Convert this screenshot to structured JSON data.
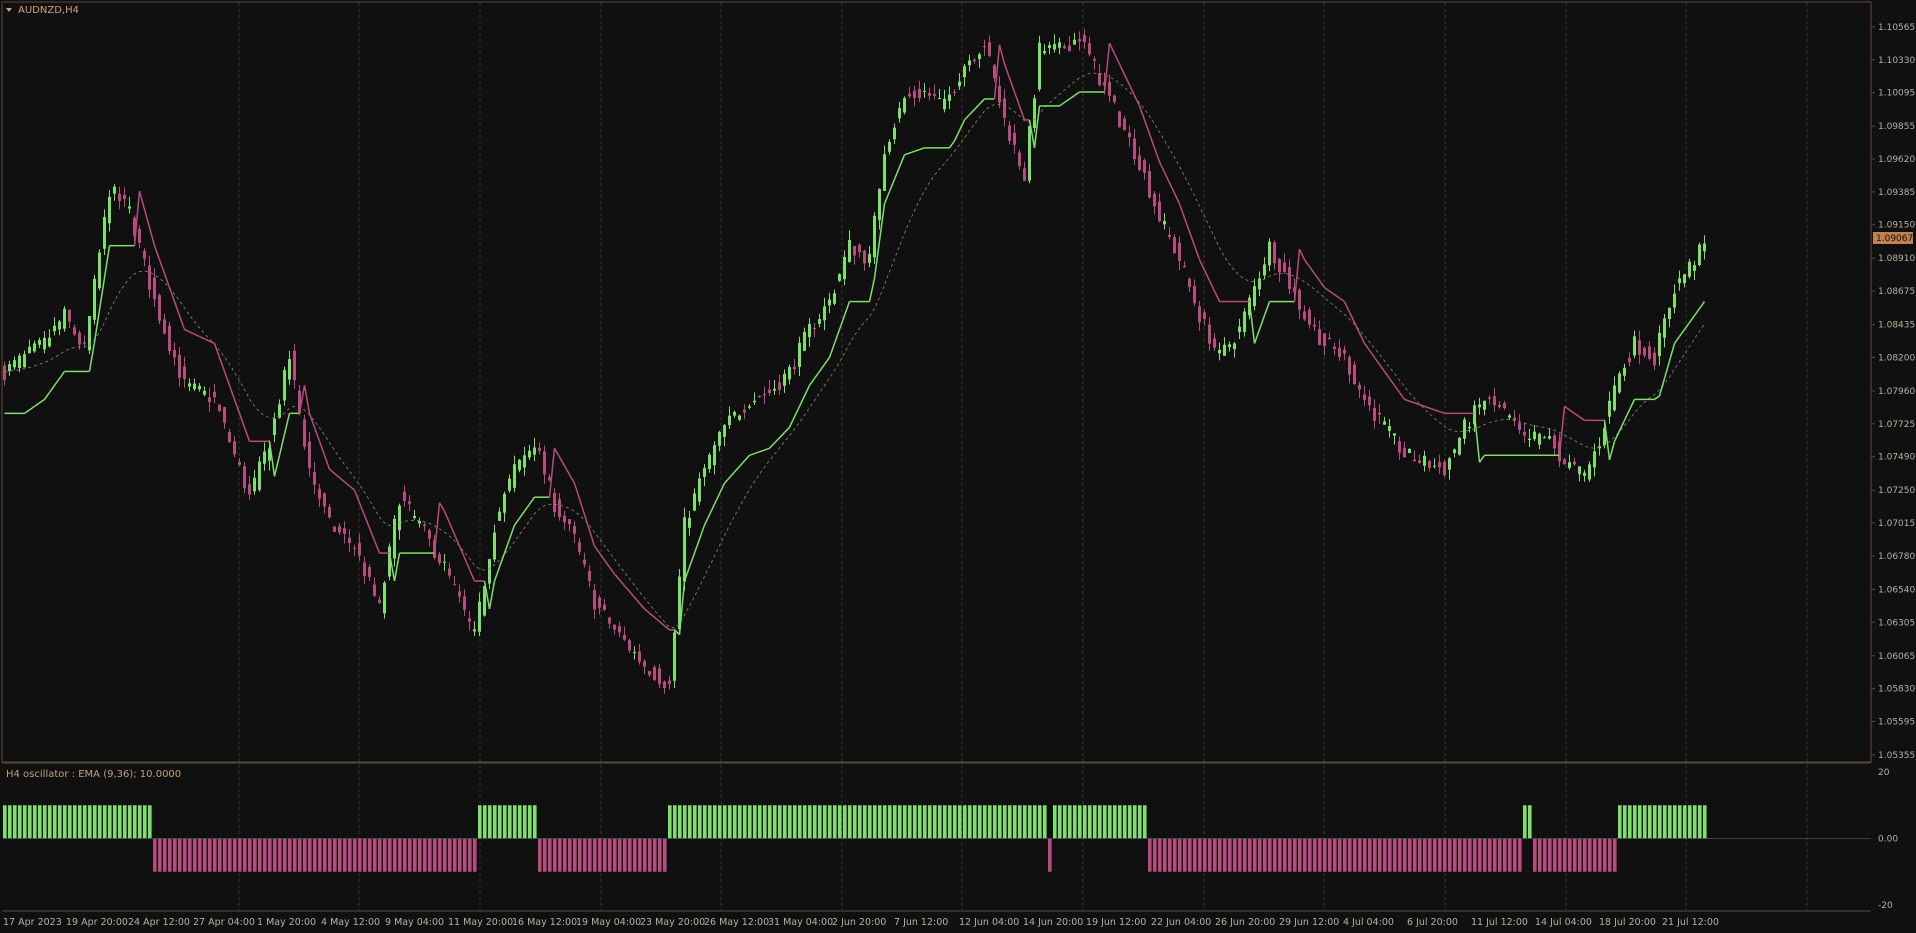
{
  "chart_title": "AUDNZD,H4",
  "oscillator_label": "H4  oscillator : EMA (9,36); 10.0000",
  "current_price_label": "1.09067",
  "colors": {
    "background": "#101010",
    "bull": "#7ee06a",
    "bear": "#b84c7c",
    "frame": "#5a4a3a",
    "grid": "#7a6a4a",
    "axis_text": "#b8b0a0",
    "title_text": "#d0a078",
    "price_tag_bg": "#c08050",
    "dashed_ma": "#8a8a7a"
  },
  "chart_data": [
    {
      "type": "candlestick",
      "title": "AUDNZD,H4",
      "y_ticks": [
        "1.10565",
        "1.10330",
        "1.10095",
        "1.09855",
        "1.09620",
        "1.09385",
        "1.09150",
        "1.08910",
        "1.08675",
        "1.08435",
        "1.08200",
        "1.07960",
        "1.07725",
        "1.07490",
        "1.07250",
        "1.07015",
        "1.06780",
        "1.06540",
        "1.06305",
        "1.06065",
        "1.05830",
        "1.05595",
        "1.05355"
      ],
      "ylim": [
        1.05355,
        1.10615
      ],
      "x_ticks": [
        "17 Apr 2023",
        "19 Apr 20:00",
        "24 Apr 12:00",
        "27 Apr 04:00",
        "1 May 20:00",
        "4 May 12:00",
        "9 May 04:00",
        "11 May 20:00",
        "16 May 12:00",
        "19 May 04:00",
        "23 May 20:00",
        "26 May 12:00",
        "31 May 04:00",
        "2 Jun 20:00",
        "7 Jun 12:00",
        "12 Jun 04:00",
        "14 Jun 20:00",
        "19 Jun 12:00",
        "22 Jun 04:00",
        "26 Jun 20:00",
        "29 Jun 12:00",
        "4 Jul 04:00",
        "6 Jul 20:00",
        "11 Jul 12:00",
        "14 Jul 04:00",
        "18 Jul 20:00",
        "21 Jul 12:00"
      ],
      "price_path": [
        [
          0,
          1.081
        ],
        [
          8,
          1.083
        ],
        [
          12,
          1.085
        ],
        [
          16,
          1.0825
        ],
        [
          21,
          1.094
        ],
        [
          25,
          1.0925
        ],
        [
          30,
          1.086
        ],
        [
          36,
          1.08
        ],
        [
          42,
          1.079
        ],
        [
          49,
          1.072
        ],
        [
          53,
          1.076
        ],
        [
          57,
          1.082
        ],
        [
          61,
          1.074
        ],
        [
          65,
          1.07
        ],
        [
          70,
          1.0685
        ],
        [
          75,
          1.064
        ],
        [
          79,
          1.072
        ],
        [
          83,
          1.07
        ],
        [
          88,
          1.067
        ],
        [
          94,
          1.062
        ],
        [
          98,
          1.07
        ],
        [
          102,
          1.074
        ],
        [
          106,
          1.076
        ],
        [
          110,
          1.0715
        ],
        [
          114,
          1.069
        ],
        [
          118,
          1.0645
        ],
        [
          122,
          1.0625
        ],
        [
          128,
          1.06
        ],
        [
          133,
          1.0585
        ],
        [
          136,
          1.07
        ],
        [
          140,
          1.074
        ],
        [
          144,
          1.077
        ],
        [
          149,
          1.079
        ],
        [
          153,
          1.0795
        ],
        [
          157,
          1.081
        ],
        [
          161,
          1.084
        ],
        [
          165,
          1.086
        ],
        [
          169,
          1.09
        ],
        [
          173,
          1.089
        ],
        [
          176,
          1.097
        ],
        [
          180,
          1.1005
        ],
        [
          184,
          1.101
        ],
        [
          188,
          1.1
        ],
        [
          192,
          1.103
        ],
        [
          196,
          1.1045
        ],
        [
          200,
          1.099
        ],
        [
          204,
          1.095
        ],
        [
          207,
          1.104
        ],
        [
          211,
          1.104
        ],
        [
          215,
          1.105
        ],
        [
          219,
          1.102
        ],
        [
          223,
          1.099
        ],
        [
          227,
          1.096
        ],
        [
          231,
          1.092
        ],
        [
          235,
          1.089
        ],
        [
          239,
          1.085
        ],
        [
          243,
          1.082
        ],
        [
          247,
          1.084
        ],
        [
          250,
          1.087
        ],
        [
          253,
          1.09
        ],
        [
          256,
          1.088
        ],
        [
          260,
          1.085
        ],
        [
          264,
          1.083
        ],
        [
          268,
          1.082
        ],
        [
          272,
          1.079
        ],
        [
          276,
          1.077
        ],
        [
          280,
          1.075
        ],
        [
          284,
          1.0745
        ],
        [
          288,
          1.074
        ],
        [
          292,
          1.077
        ],
        [
          296,
          1.079
        ],
        [
          300,
          1.078
        ],
        [
          304,
          1.076
        ],
        [
          308,
          1.0765
        ],
        [
          312,
          1.0745
        ],
        [
          316,
          1.0735
        ],
        [
          319,
          1.076
        ],
        [
          322,
          1.08
        ],
        [
          326,
          1.083
        ],
        [
          330,
          1.082
        ],
        [
          334,
          1.087
        ],
        [
          338,
          1.089
        ],
        [
          340,
          1.09
        ]
      ],
      "n_bars": 341,
      "oscillator": {
        "title": "H4  oscillator : EMA (9,36); 10.0000",
        "y_ticks": [
          "20",
          "0.00",
          "-20"
        ],
        "ylim": [
          -20,
          20
        ],
        "sign_segments": [
          {
            "from": 0,
            "to": 29,
            "sign": 1
          },
          {
            "from": 30,
            "to": 94,
            "sign": -1
          },
          {
            "from": 95,
            "to": 106,
            "sign": 1
          },
          {
            "from": 107,
            "to": 132,
            "sign": -1
          },
          {
            "from": 133,
            "to": 208,
            "sign": 1
          },
          {
            "from": 209,
            "to": 209,
            "sign": -1
          },
          {
            "from": 210,
            "to": 228,
            "sign": 1
          },
          {
            "from": 229,
            "to": 303,
            "sign": -1
          },
          {
            "from": 304,
            "to": 305,
            "sign": 1
          },
          {
            "from": 306,
            "to": 322,
            "sign": -1
          },
          {
            "from": 323,
            "to": 340,
            "sign": 1
          }
        ]
      }
    }
  ]
}
